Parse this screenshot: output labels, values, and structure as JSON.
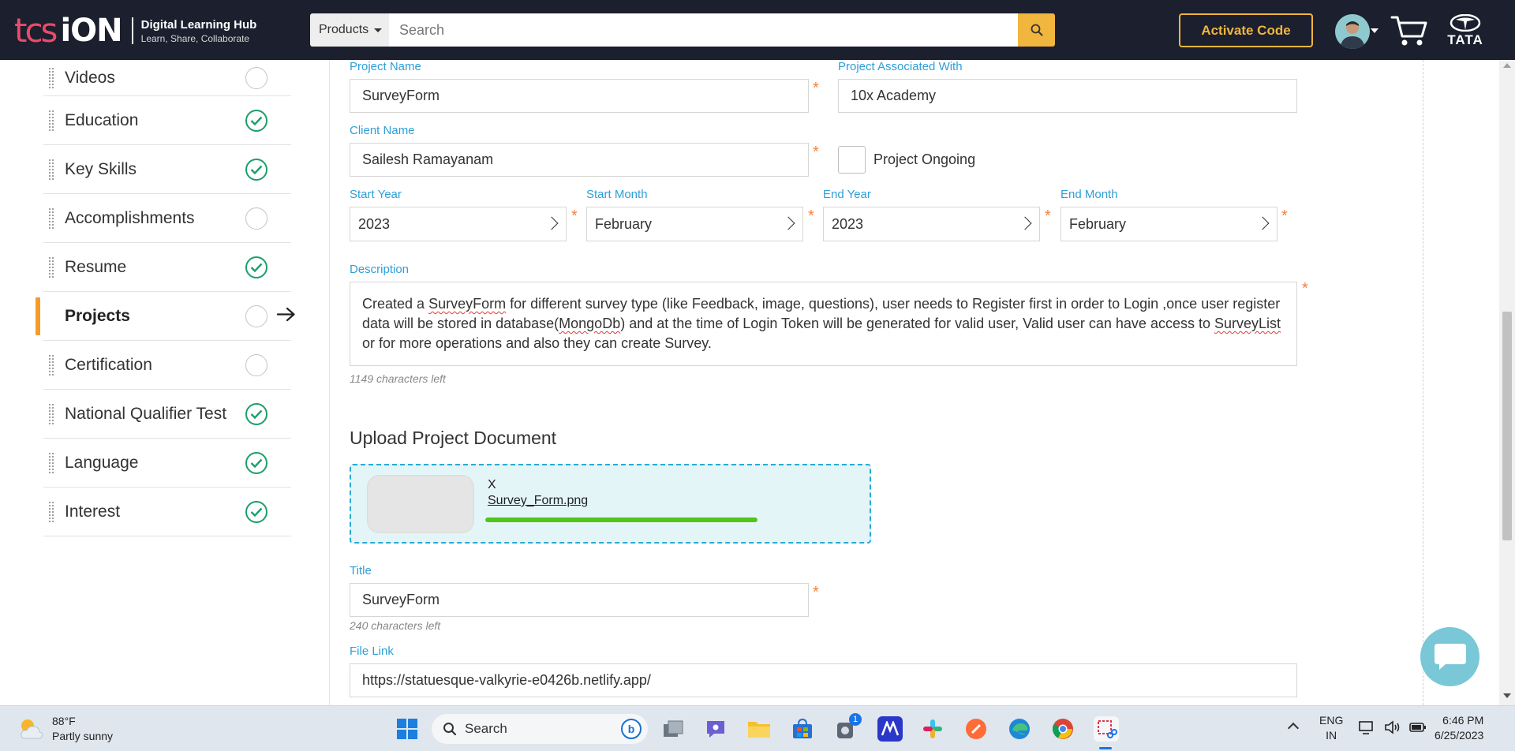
{
  "header": {
    "logo_tcs": "tcs",
    "logo_ion": "iON",
    "logo_title": "Digital Learning Hub",
    "logo_tagline": "Learn, Share, Collaborate",
    "products_label": "Products",
    "search_placeholder": "Search",
    "activate_label": "Activate Code",
    "tata_label": "TATA",
    "accent_color": "#f0b63d"
  },
  "sidebar": {
    "items": [
      {
        "label": "Videos",
        "status": "empty"
      },
      {
        "label": "Education",
        "status": "done"
      },
      {
        "label": "Key Skills",
        "status": "done"
      },
      {
        "label": "Accomplishments",
        "status": "empty"
      },
      {
        "label": "Resume",
        "status": "done"
      },
      {
        "label": "Projects",
        "status": "empty",
        "active": true
      },
      {
        "label": "Certification",
        "status": "empty"
      },
      {
        "label": "National Qualifier Test",
        "status": "done"
      },
      {
        "label": "Language",
        "status": "done"
      },
      {
        "label": "Interest",
        "status": "done"
      }
    ],
    "active_color": "#f39c2a",
    "done_color": "#1e9e6a"
  },
  "form": {
    "project_name_label": "Project Name",
    "project_name_value": "SurveyForm",
    "associated_label": "Project Associated With",
    "associated_value": "10x Academy",
    "client_label": "Client Name",
    "client_value": "Sailesh Ramayanam",
    "ongoing_label": "Project Ongoing",
    "start_year_label": "Start Year",
    "start_year_value": "2023",
    "start_month_label": "Start Month",
    "start_month_value": "February",
    "end_year_label": "End Year",
    "end_year_value": "2023",
    "end_month_label": "End Month",
    "end_month_value": "February",
    "description_label": "Description",
    "description_parts": [
      "Created a ",
      "SurveyForm",
      " for different survey type (like Feedback, image, questions), user needs to Register first in order to Login ,once user register data will be stored in database(",
      "MongoDb",
      ") and at the time of Login Token will be generated for valid user, Valid user can have access to ",
      "SurveyList",
      " or for more operations and also they can create Survey."
    ],
    "description_chars_left": "1149 characters left",
    "upload_title": "Upload Project Document",
    "upload_remove": "X",
    "upload_filename": "Survey_Form.png",
    "upload_progress": 1.0,
    "title_label": "Title",
    "title_value": "SurveyForm",
    "title_chars_left": "240 characters left",
    "file_link_label": "File Link",
    "file_link_value": "https://statuesque-valkyrie-e0426b.netlify.app/",
    "required_mark": "*",
    "label_color": "#2f9fd6",
    "required_color": "#f5803e"
  },
  "taskbar": {
    "temperature": "88°F",
    "weather": "Partly sunny",
    "search_label": "Search",
    "lang_line1": "ENG",
    "lang_line2": "IN",
    "time": "6:46 PM",
    "date": "6/25/2023",
    "notification_badge": "1"
  }
}
